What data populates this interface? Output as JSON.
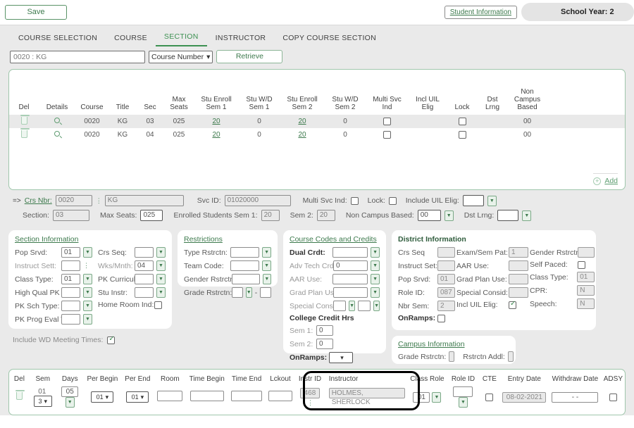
{
  "topbar": {
    "save_label": "Save",
    "student_information_label": "Student Information",
    "school_year_label": "School Year: 2"
  },
  "tabs": [
    {
      "label": "COURSE SELECTION",
      "active": false
    },
    {
      "label": "COURSE",
      "active": false
    },
    {
      "label": "SECTION",
      "active": true
    },
    {
      "label": "INSTRUCTOR",
      "active": false
    },
    {
      "label": "COPY COURSE SECTION",
      "active": false
    }
  ],
  "search": {
    "course_value": "0020 : KG",
    "select_value": "Course Number",
    "retrieve_label": "Retrieve"
  },
  "grid": {
    "columns": [
      "Del",
      "Details",
      "Course",
      "Title",
      "Sec",
      "Max\nSeats",
      "Stu Enroll\nSem 1",
      "Stu W/D\nSem 1",
      "Stu Enroll\nSem 2",
      "Stu W/D\nSem 2",
      "Multi Svc\nInd",
      "Incl UIL\nElig",
      "Lock",
      "Dst\nLrng",
      "Non\nCampus\nBased"
    ],
    "rows": [
      {
        "course": "0020",
        "title": "KG",
        "sec": "03",
        "max_seats": "025",
        "stu_enroll_sem1": "20",
        "stu_wd_sem1": "0",
        "stu_enroll_sem2": "20",
        "stu_wd_sem2": "0",
        "multi_svc_ind": false,
        "incl_uil_elig": "",
        "lock": false,
        "dst_lrng": "",
        "non_campus_based": "00"
      },
      {
        "course": "0020",
        "title": "KG",
        "sec": "04",
        "max_seats": "025",
        "stu_enroll_sem1": "20",
        "stu_wd_sem1": "0",
        "stu_enroll_sem2": "20",
        "stu_wd_sem2": "0",
        "multi_svc_ind": false,
        "incl_uil_elig": "",
        "lock": false,
        "dst_lrng": "",
        "non_campus_based": "00"
      }
    ],
    "add_label": "Add"
  },
  "keyfields": {
    "crs_nbr_label": "Crs Nbr:",
    "crs_nbr_value": "0020",
    "crs_title_value": "KG",
    "svc_id_label": "Svc ID:",
    "svc_id_value": "01020000",
    "multi_svc_ind_label": "Multi Svc Ind:",
    "lock_label": "Lock:",
    "include_uil_elig_label": "Include UIL Elig:",
    "include_uil_elig_value": "",
    "section_label": "Section:",
    "section_value": "03",
    "max_seats_label": "Max Seats:",
    "max_seats_value": "025",
    "enrolled_sem1_label": "Enrolled Students Sem 1:",
    "enrolled_sem1_value": "20",
    "sem2_label": "Sem 2:",
    "sem2_value": "20",
    "non_campus_based_label": "Non Campus Based:",
    "non_campus_based_value": "00",
    "dst_lrng_label": "Dst Lrng:",
    "dst_lrng_value": ""
  },
  "section_information": {
    "title": "Section Information",
    "pop_srvd_label": "Pop Srvd:",
    "pop_srvd_value": "01",
    "instruct_sett_label": "Instruct Sett:",
    "instruct_sett_value": "",
    "class_type_label": "Class Type:",
    "class_type_value": "01",
    "high_qual_pk_prog_label": "High Qual PK Prog:",
    "high_qual_pk_prog_value": "",
    "pk_sch_type_label": "PK Sch Type:",
    "pk_sch_type_value": "",
    "pk_prog_eval_type_label": "PK Prog Eval Type:",
    "pk_prog_eval_type_value": "",
    "crs_seq_label": "Crs Seq:",
    "crs_seq_value": "",
    "wks_mnth_label": "Wks/Mnth:",
    "wks_mnth_value": "04",
    "pk_curricula_label": "PK Curricula:",
    "pk_curricula_value": "",
    "stu_instr_label": "Stu Instr:",
    "stu_instr_value": "",
    "home_room_ind_label": "Home Room Ind:",
    "home_room_ind_checked": false
  },
  "include_wd": {
    "label": "Include WD Meeting Times:",
    "checked": true
  },
  "restrictions": {
    "title": "Restrictions",
    "type_rstrctn_label": "Type Rstrctn:",
    "type_rstrctn_value": "",
    "team_code_label": "Team Code:",
    "team_code_value": "",
    "gender_rstrctn_label": "Gender Rstrctn:",
    "gender_rstrctn_value": "",
    "grade_rstrctn_label": "Grade Rstrctn:",
    "grade_rstrctn_value": "",
    "grade_rstrctn_sep": "-",
    "grade_rstrctn_value2": ""
  },
  "course_codes": {
    "title": "Course Codes and Credits",
    "dual_crdt_label": "Dual Crdt:",
    "dual_crdt_value": "",
    "adv_tech_crdt_label": "Adv Tech Crdt:",
    "adv_tech_crdt_value": "0",
    "aar_use_label": "AAR Use:",
    "aar_use_value": "",
    "grad_plan_use_label": "Grad Plan Use:",
    "grad_plan_use_value": "",
    "special_consid_label": "Special Consid:",
    "special_consid_value": "",
    "special_consid_value2": "",
    "college_credit_hrs_label": "College Credit Hrs",
    "sem1_label": "Sem 1:",
    "sem1_value": "0",
    "sem2_label": "Sem 2:",
    "sem2_value": "0",
    "onramps_label": "OnRamps:",
    "onramps_value": ""
  },
  "district_information": {
    "title": "District Information",
    "crs_seq_label": "Crs Seq",
    "crs_seq_value": "",
    "instruct_set_label": "Instruct Set:",
    "instruct_set_value": "",
    "pop_srvd_label": "Pop Srvd:",
    "pop_srvd_value": "01",
    "role_id_label": "Role ID:",
    "role_id_value": "087",
    "nbr_sem_label": "Nbr Sem:",
    "nbr_sem_value": "2",
    "onramps_label": "OnRamps:",
    "onramps_checked": false,
    "exam_sem_pat_label": "Exam/Sem Pat:",
    "exam_sem_pat_value": "1",
    "aar_use_label": "AAR Use:",
    "aar_use_value": "",
    "grad_plan_use_label": "Grad Plan Use:",
    "grad_plan_use_value": "",
    "special_consid_label": "Special Consid:",
    "special_consid_value": "",
    "incl_uil_elig_label": "Incl UIL Elig:",
    "incl_uil_elig_checked": true,
    "gender_rstrctn_label": "Gender Rstrctn:",
    "gender_rstrctn_value": "",
    "self_paced_label": "Self Paced:",
    "self_paced_checked": false,
    "class_type_label": "Class Type:",
    "class_type_value": "01",
    "cpr_label": "CPR:",
    "cpr_value": "N",
    "speech_label": "Speech:",
    "speech_value": "N"
  },
  "campus_information": {
    "title": "Campus Information",
    "grade_rstrctn_label": "Grade Rstrctn:",
    "grade_rstrctn_value": "",
    "rstrctn_addl_label": "Rstrctn Addl:",
    "rstrctn_addl_value": ""
  },
  "instructor_grid": {
    "columns": [
      "Del",
      "Sem",
      "Days",
      "Per Begin",
      "Per End",
      "Room",
      "Time Begin",
      "Time End",
      "Lckout",
      "Instr ID",
      "Instructor",
      "Class Role",
      "Role ID",
      "CTE",
      "Entry Date",
      "Withdraw Date",
      "ADSY"
    ],
    "row": {
      "sem_static": "01",
      "sem_value": "3",
      "days_value": "05",
      "per_begin_value": "01",
      "per_end_value": "01",
      "room_value": "",
      "time_begin_value": "",
      "time_end_value": "",
      "lckout_value": "",
      "instr_id_value": "468",
      "instructor_value": "HOLMES, SHERLOCK",
      "class_role_value": "01",
      "role_id_value": "",
      "cte_checked": false,
      "entry_date_value": "08-02-2021",
      "withdraw_date_value": "-  -",
      "adsy_checked": false
    }
  },
  "colors": {
    "accent_green": "#3d9152",
    "panel_border_green": "#9fc6ab",
    "page_bg": "#eaeaea",
    "highlight_box": "#000000"
  }
}
